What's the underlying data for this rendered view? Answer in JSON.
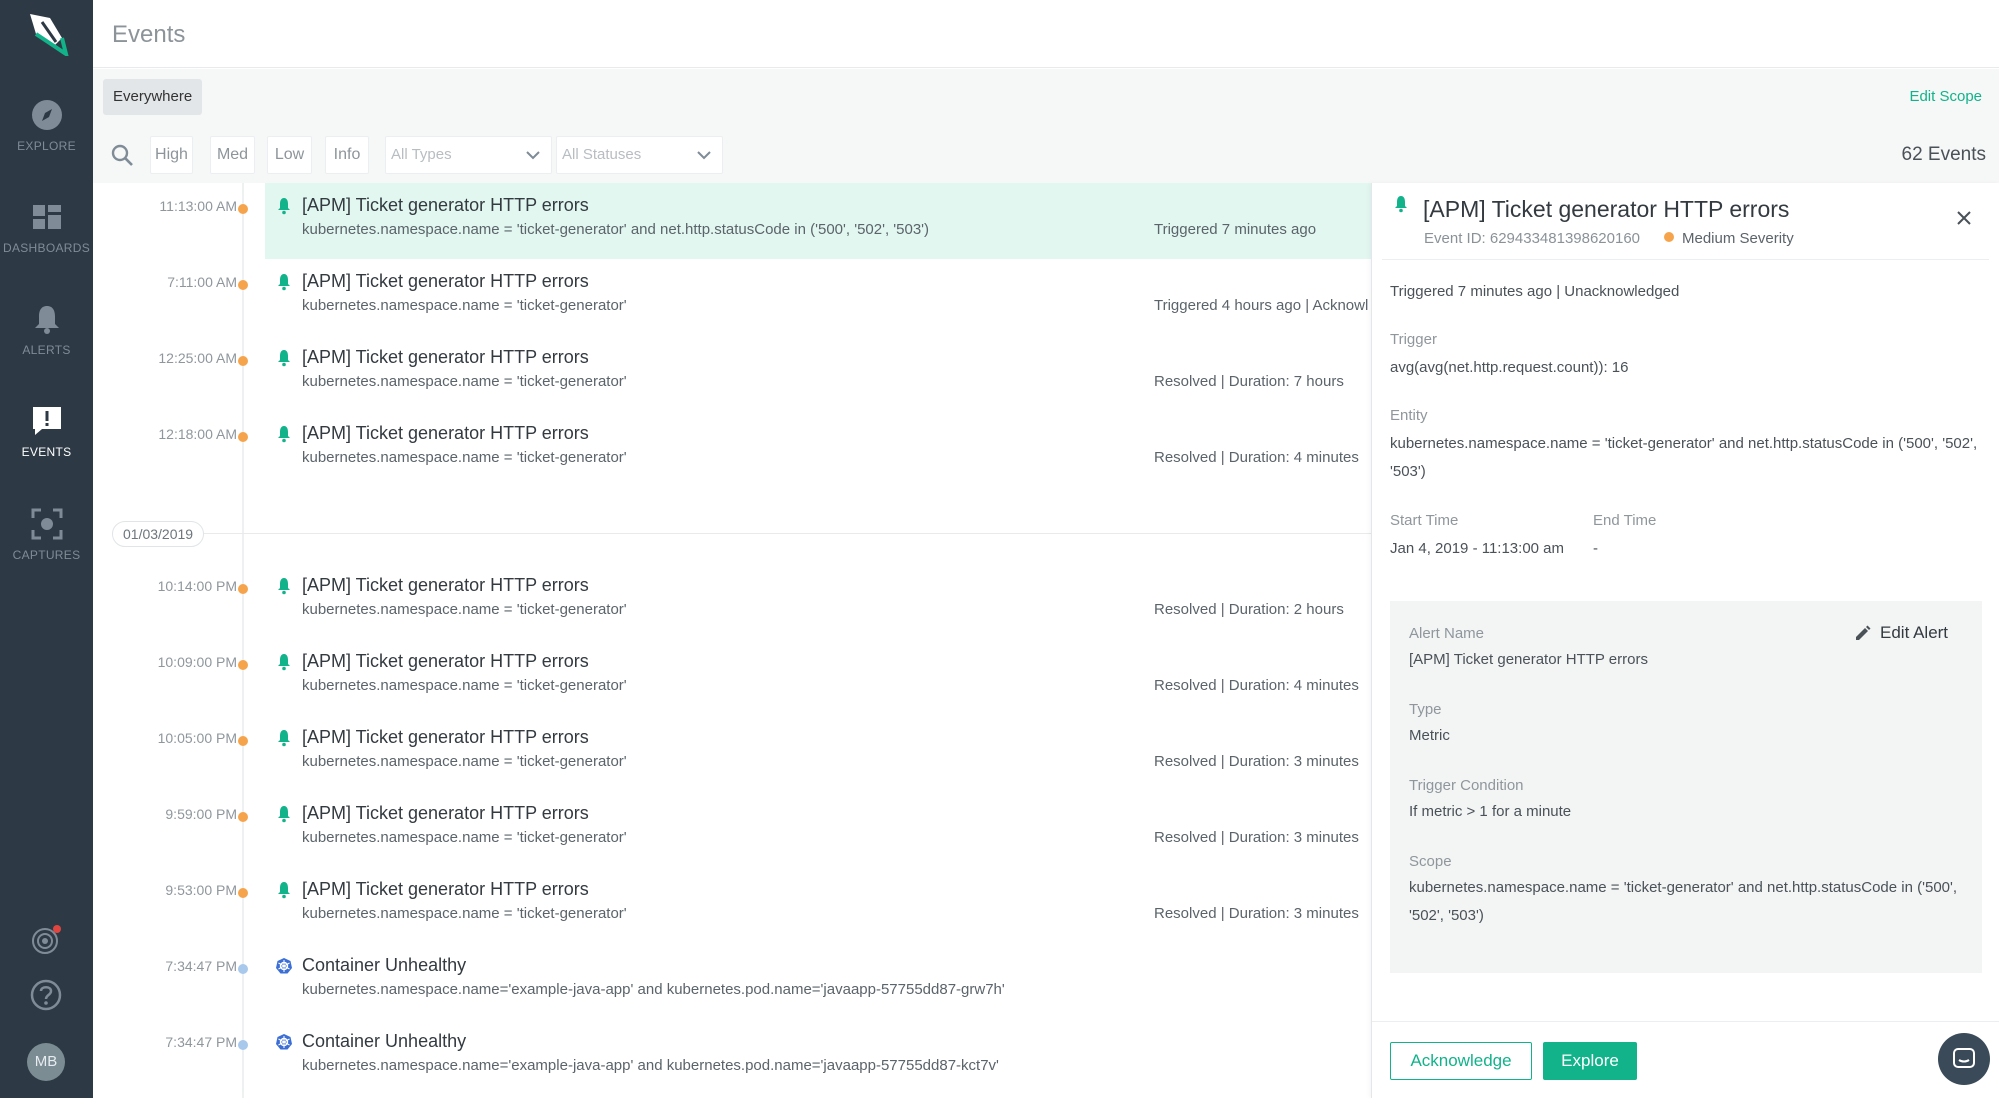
{
  "colors": {
    "sidebar_bg": "#2d3a46",
    "accent": "#12b38a",
    "medium_severity": "#f6a44c",
    "info": "#a8c8ec",
    "selected_row": "#e2f7ef"
  },
  "sidebar": {
    "items": [
      {
        "label": "EXPLORE",
        "icon": "compass-icon"
      },
      {
        "label": "DASHBOARDS",
        "icon": "dashboard-icon"
      },
      {
        "label": "ALERTS",
        "icon": "bell-icon"
      },
      {
        "label": "EVENTS",
        "icon": "events-icon",
        "active": true
      },
      {
        "label": "CAPTURES",
        "icon": "capture-icon"
      }
    ],
    "avatar": "MB"
  },
  "header": {
    "title": "Events"
  },
  "scope": {
    "chip": "Everywhere",
    "edit": "Edit Scope"
  },
  "filters": {
    "severity": [
      "High",
      "Med",
      "Low",
      "Info"
    ],
    "types_placeholder": "All Types",
    "statuses_placeholder": "All Statuses",
    "count": "62 Events"
  },
  "events": [
    {
      "time": "11:13:00 AM",
      "title": "[APM] Ticket generator HTTP errors",
      "desc": "kubernetes.namespace.name = 'ticket-generator' and net.http.statusCode in ('500', '502', '503')",
      "status": "Triggered 7 minutes ago",
      "severity": "medium",
      "icon": "bell-icon"
    },
    {
      "time": "7:11:00 AM",
      "title": "[APM] Ticket generator HTTP errors",
      "desc": "kubernetes.namespace.name = 'ticket-generator'",
      "status": "Triggered 4 hours ago | Acknowl",
      "severity": "medium",
      "icon": "bell-icon"
    },
    {
      "time": "12:25:00 AM",
      "title": "[APM] Ticket generator HTTP errors",
      "desc": "kubernetes.namespace.name = 'ticket-generator'",
      "status": "Resolved | Duration: 7 hours",
      "severity": "medium",
      "icon": "bell-icon"
    },
    {
      "time": "12:18:00 AM",
      "title": "[APM] Ticket generator HTTP errors",
      "desc": "kubernetes.namespace.name = 'ticket-generator'",
      "status": "Resolved | Duration: 4 minutes",
      "severity": "medium",
      "icon": "bell-icon"
    },
    {
      "time": "10:14:00 PM",
      "title": "[APM] Ticket generator HTTP errors",
      "desc": "kubernetes.namespace.name = 'ticket-generator'",
      "status": "Resolved | Duration: 2 hours",
      "severity": "medium",
      "icon": "bell-icon"
    },
    {
      "time": "10:09:00 PM",
      "title": "[APM] Ticket generator HTTP errors",
      "desc": "kubernetes.namespace.name = 'ticket-generator'",
      "status": "Resolved | Duration: 4 minutes",
      "severity": "medium",
      "icon": "bell-icon"
    },
    {
      "time": "10:05:00 PM",
      "title": "[APM] Ticket generator HTTP errors",
      "desc": "kubernetes.namespace.name = 'ticket-generator'",
      "status": "Resolved | Duration: 3 minutes",
      "severity": "medium",
      "icon": "bell-icon"
    },
    {
      "time": "9:59:00 PM",
      "title": "[APM] Ticket generator HTTP errors",
      "desc": "kubernetes.namespace.name = 'ticket-generator'",
      "status": "Resolved | Duration: 3 minutes",
      "severity": "medium",
      "icon": "bell-icon"
    },
    {
      "time": "9:53:00 PM",
      "title": "[APM] Ticket generator HTTP errors",
      "desc": "kubernetes.namespace.name = 'ticket-generator'",
      "status": "Resolved | Duration: 3 minutes",
      "severity": "medium",
      "icon": "bell-icon"
    },
    {
      "time": "7:34:47 PM",
      "title": "Container Unhealthy",
      "desc": "kubernetes.namespace.name='example-java-app' and kubernetes.pod.name='javaapp-57755dd87-grw7h'",
      "status": "",
      "severity": "info",
      "icon": "kubernetes-icon"
    },
    {
      "time": "7:34:47 PM",
      "title": "Container Unhealthy",
      "desc": "kubernetes.namespace.name='example-java-app' and kubernetes.pod.name='javaapp-57755dd87-kct7v'",
      "status": "",
      "severity": "info",
      "icon": "kubernetes-icon"
    }
  ],
  "date_separator": "01/03/2019",
  "detail": {
    "title": "[APM] Ticket generator HTTP errors",
    "event_id": "Event ID: 629433481398620160",
    "severity": "Medium Severity",
    "summary": "Triggered 7 minutes ago | Unacknowledged",
    "trigger_label": "Trigger",
    "trigger_value": "avg(avg(net.http.request.count)): 16",
    "entity_label": "Entity",
    "entity_value": "kubernetes.namespace.name = 'ticket-generator' and net.http.statusCode in ('500', '502', '503')",
    "start_label": "Start Time",
    "start_value": "Jan 4, 2019 - 11:13:00 am",
    "end_label": "End Time",
    "end_value": "-",
    "alert_name_label": "Alert Name",
    "alert_name_value": "[APM] Ticket generator HTTP errors",
    "edit_alert": "Edit Alert",
    "type_label": "Type",
    "type_value": "Metric",
    "condition_label": "Trigger Condition",
    "condition_value": "If metric > 1 for a minute",
    "scope_label": "Scope",
    "scope_value": "kubernetes.namespace.name = 'ticket-generator' and net.http.statusCode in ('500', '502', '503')",
    "acknowledge": "Acknowledge",
    "explore": "Explore"
  }
}
